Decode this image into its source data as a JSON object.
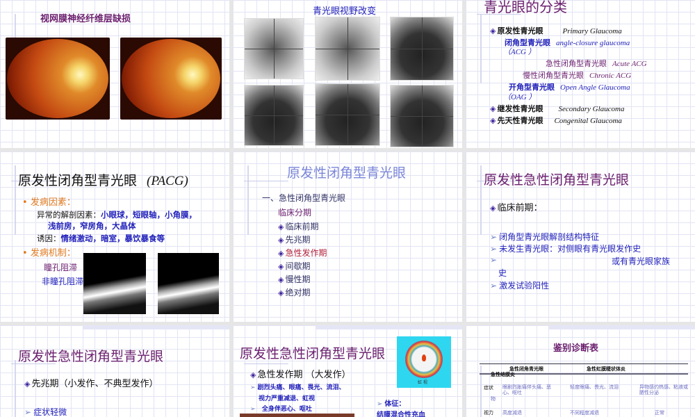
{
  "slides": [
    {
      "title": "视网膜神经纤维层缺损"
    },
    {
      "title": "青光眼视野改变"
    },
    {
      "title": "青光眼的分类",
      "lines": [
        {
          "cn": "原发性青光眼",
          "en": "Primary Glaucoma"
        },
        {
          "cn": "闭角型青光眼",
          "en": "angle-closure glaucoma",
          "en2": "（ACG ）"
        },
        {
          "cn": "急性闭角型青光眼",
          "en": "Acute ACG"
        },
        {
          "cn": "慢性闭角型青光眼",
          "en": "Chronic ACG"
        },
        {
          "cn": "开角型青光眼",
          "en": "Open Angle Glaucoma",
          "en2": "（OAG ）"
        },
        {
          "cn": "继发性青光眼",
          "en": "Secondary Glaucoma"
        },
        {
          "cn": "先天性青光眼",
          "en": "Congenital Glaucoma"
        }
      ]
    },
    {
      "title": "原发性闭角型青光眼",
      "title_en": "(PACG)",
      "factors": "发病因素：",
      "anat_label": "异常的解剖因素：",
      "anat1": "小眼球，短眼轴，小角膜，",
      "anat2": "浅前房，窄房角，大晶体",
      "induce_label": "诱因：",
      "induce": "情绪激动，暗室，暴饮暴食等",
      "mech": "发病机制：",
      "mech1": "瞳孔阻滞",
      "mech2": "非瞳孔阻滞"
    },
    {
      "title": "原发性闭角型青光眼",
      "sub": "一、急性闭角型青光眼",
      "stage_label": "临床分期",
      "stages": [
        "临床前期",
        "先兆期",
        "急性发作期",
        "间歇期",
        "慢性期",
        "绝对期"
      ]
    },
    {
      "title": "原发性急性闭角型青光眼",
      "head": "临床前期：",
      "items": [
        "闭角型青光眼解剖结构特征",
        "未发生青光眼：对侧眼有青光眼发作史",
        "或有青光眼家族",
        "史",
        "激发试验阳性"
      ]
    },
    {
      "title": "原发性急性闭角型青光眼",
      "head": "先兆期（小发作、不典型发作）",
      "item": "症状轻微"
    },
    {
      "title": "原发性急性闭角型青光眼",
      "head": "急性发作期 （大发作）",
      "items": [
        "剧烈头痛、眼痛、畏光、流泪、",
        "视力严重减退、虹视",
        "全身伴恶心、呕吐"
      ],
      "sign_label": "体征：",
      "sign": "结膜混合性充血",
      "diagram_caption": "虹 视"
    },
    {
      "title": "鉴别诊断表",
      "headers": [
        "急性闭角青光眼",
        "急性虹膜睫状体炎",
        "急性结膜炎"
      ],
      "rows": [
        {
          "label": "症状",
          "label2": "物",
          "cells": [
            "眼剧烈胀痛伴头痛、恶心、呕吐",
            "轻度眼痛、畏光、流泪",
            "异物感灼热感、粘液或脓性分泌"
          ]
        },
        {
          "label": "视力",
          "cells": [
            "高度减退",
            "不同程度减退",
            "正常"
          ]
        }
      ]
    }
  ]
}
